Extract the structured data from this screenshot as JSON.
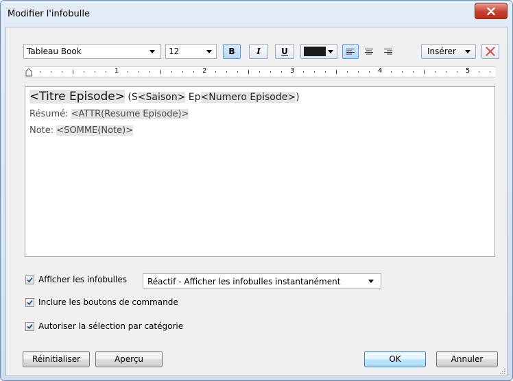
{
  "window": {
    "title": "Modifier l'infobulle",
    "close_glyph": "x"
  },
  "toolbar": {
    "font": "Tableau Book",
    "size": "12",
    "bold": "B",
    "italic": "I",
    "underline": "U",
    "text_color": "#1a1a1a",
    "insert": "Insérer",
    "clear_icon": "clear-format-icon"
  },
  "ruler": {
    "labels": [
      "1",
      "2",
      "3",
      "4",
      "5"
    ]
  },
  "editor": {
    "title_field": "<Titre Episode>",
    "open_paren": " (S",
    "season_field": "<Saison>",
    "ep_prefix": " Ep",
    "number_field": "<Numero Episode>",
    "close_paren": ")",
    "summary_label": "Résumé: ",
    "summary_field": "<ATTR(Resume Episode)>",
    "note_label": "Note: ",
    "note_field": "<SOMME(Note)>"
  },
  "options": {
    "show_tooltips": "Afficher les infobulles",
    "tooltip_mode": "Réactif - Afficher les infobulles instantanément",
    "include_buttons": "Inclure les boutons de commande",
    "category_selection": "Autoriser la sélection par catégorie"
  },
  "buttons": {
    "reset": "Réinitialiser",
    "preview": "Aperçu",
    "ok": "OK",
    "cancel": "Annuler"
  }
}
